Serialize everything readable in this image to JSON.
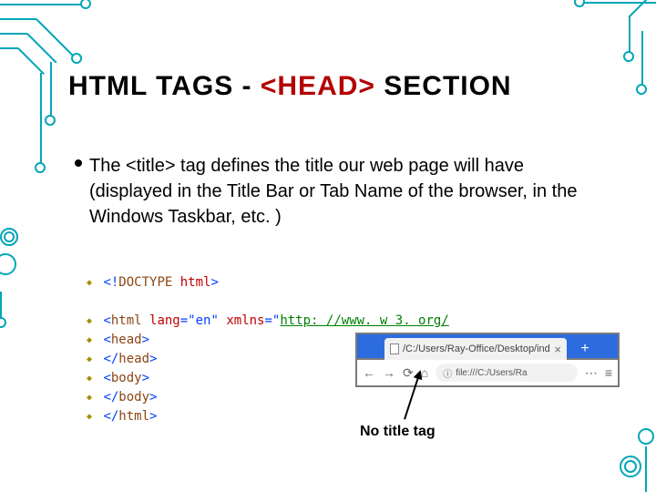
{
  "heading": {
    "part1": "HTML TAGS - ",
    "red": "<HEAD>",
    "part3": " SECTION"
  },
  "body": "The <title> tag defines the title our web page will have (displayed in the Title Bar or Tab Name of the browser, in the Windows Taskbar, etc. )",
  "code": {
    "l1a": "<!",
    "l1b": "DOCTYPE",
    "l1c": " html",
    "l1d": ">",
    "l2a": "<",
    "l2b": "html",
    "l2c": " lang",
    "l2d": "=\"en\"",
    "l2e": " xmlns",
    "l2f": "=\"",
    "l2g": "http: //www. w 3. org/",
    "l3a": "<",
    "l3b": "head",
    "l3c": ">",
    "l4a": "</",
    "l4b": "head",
    "l4c": ">",
    "l5a": "<",
    "l5b": "body",
    "l5c": ">",
    "l6a": "</",
    "l6b": "body",
    "l6c": ">",
    "l7a": "</",
    "l7b": "html",
    "l7c": ">"
  },
  "browser": {
    "tab_text": "/C:/Users/Ray-Office/Desktop/ind",
    "tab_close": "×",
    "plus": "+",
    "back": "←",
    "fwd": "→",
    "reload": "⟳",
    "home": "⌂",
    "url_prefix": "ⓘ",
    "url": "file:///C:/Users/Ra",
    "menu": "⋯",
    "more": "≡"
  },
  "caption": "No title tag"
}
